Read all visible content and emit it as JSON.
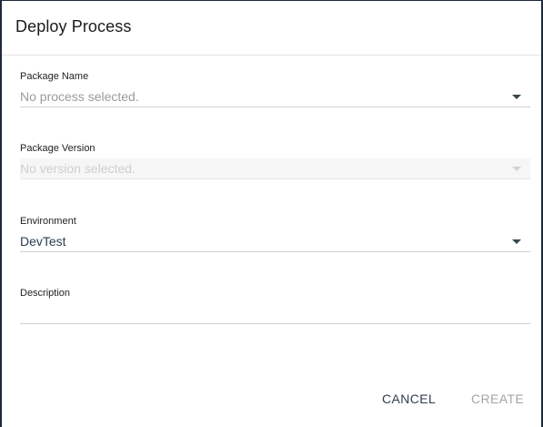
{
  "dialog": {
    "title": "Deploy Process"
  },
  "fields": {
    "package_name": {
      "label": "Package Name",
      "placeholder": "No process selected."
    },
    "package_version": {
      "label": "Package Version",
      "placeholder": "No version selected."
    },
    "environment": {
      "label": "Environment",
      "value": "DevTest"
    },
    "description": {
      "label": "Description",
      "value": ""
    }
  },
  "actions": {
    "cancel_label": "CANCEL",
    "create_label": "CREATE"
  },
  "colors": {
    "accent_text": "#2c3e50",
    "disabled_text": "#a5a5a5",
    "divider": "#cfcfcf"
  }
}
